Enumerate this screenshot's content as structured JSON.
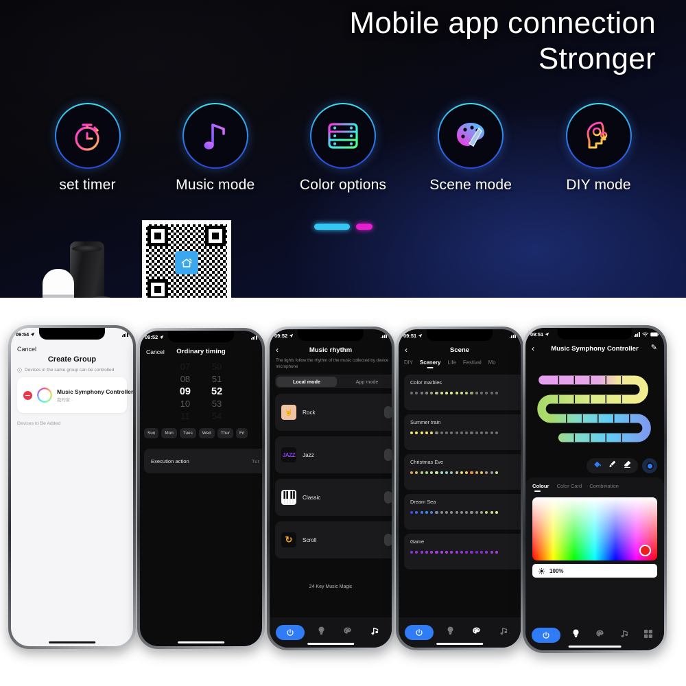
{
  "hero": {
    "title_line1": "Mobile app connection",
    "title_line2": "Stronger",
    "features": [
      {
        "label": "set timer",
        "icon": "stopwatch-timer-icon"
      },
      {
        "label": "Music mode",
        "icon": "music-note-icon"
      },
      {
        "label": "Color options",
        "icon": "led-strip-color-icon"
      },
      {
        "label": "Scene mode",
        "icon": "palette-brush-icon"
      },
      {
        "label": "DIY mode",
        "icon": "head-gears-icon"
      }
    ],
    "pager": {
      "active": "cyan-pill",
      "inactive": "magenta-pill"
    },
    "speakers_alt": "google-home-amazon-echo-speakers",
    "qr_alt": "qr-code-with-smart-home-logo"
  },
  "phones": [
    {
      "id": "create-group",
      "status": {
        "time": "09:54",
        "location_icon": "location-arrow-icon",
        "signal_icon": "signal-bars-icon"
      },
      "cancel": "Cancel",
      "title": "Create Group",
      "hint_icon": "info-icon",
      "hint": "Devices in the same group can be controlled",
      "device": {
        "name": "Music Symphony Controller",
        "sub": "我的家 ·",
        "remove_icon": "remove-minus-icon",
        "avatar_icon": "rainbow-ring-icon"
      },
      "footer": "Devices to Be Added"
    },
    {
      "id": "ordinary-timing",
      "status": {
        "time": "09:52"
      },
      "cancel": "Cancel",
      "title": "Ordinary timing",
      "hours": [
        "07",
        "08",
        "09",
        "10",
        "11"
      ],
      "minutes": [
        "50",
        "51",
        "52",
        "53",
        "54"
      ],
      "selected_hour": "09",
      "selected_minute": "52",
      "days": [
        "Sun",
        "Mon",
        "Tues",
        "Wed",
        "Thur",
        "Fri"
      ],
      "execution": {
        "label": "Execution action",
        "value": "Tur"
      }
    },
    {
      "id": "music-rhythm",
      "status": {
        "time": "09:52"
      },
      "title": "Music rhythm",
      "back_icon": "chevron-left-icon",
      "description": "The lights follow the rhythm of the music collected by device microphone",
      "segments": [
        {
          "label": "Local mode",
          "active": true
        },
        {
          "label": "App mode",
          "active": false
        }
      ],
      "modes": [
        {
          "label": "Rock",
          "icon": "rock-hand-icon",
          "glyph": "🤘"
        },
        {
          "label": "Jazz",
          "icon": "jazz-text-icon",
          "glyph": "JAZZ"
        },
        {
          "label": "Classic",
          "icon": "piano-keys-icon",
          "glyph": ""
        },
        {
          "label": "Scroll",
          "icon": "refresh-loop-icon",
          "glyph": "↻"
        }
      ],
      "overlay_label": "24 Key Music Magic",
      "bottom_nav": [
        {
          "icon": "power-icon",
          "active": true
        },
        {
          "icon": "bulb-icon",
          "active": false
        },
        {
          "icon": "palette-icon",
          "active": false
        },
        {
          "icon": "music-note-icon",
          "active": true
        }
      ]
    },
    {
      "id": "scene",
      "status": {
        "time": "09:51"
      },
      "title": "Scene",
      "back_icon": "chevron-left-icon",
      "tabs": [
        {
          "label": "DIY",
          "active": false
        },
        {
          "label": "Scenery",
          "active": true
        },
        {
          "label": "Life",
          "active": false
        },
        {
          "label": "Festival",
          "active": false
        },
        {
          "label": "Mo",
          "active": false
        }
      ],
      "scenes": [
        {
          "name": "Color marbles",
          "colors": [
            "#6e6e70",
            "#6e6e70",
            "#7d7d7f",
            "#8d8d80",
            "#a0a585",
            "#b9c98a",
            "#cfe58c",
            "#d9ee8d",
            "#dff28e",
            "#daec8c",
            "#cde28a",
            "#b8cf86",
            "#9aa87e",
            "#7d7d7f",
            "#6e6e70",
            "#6e6e70",
            "#6e6e70",
            "#6e6e70"
          ]
        },
        {
          "name": "Summer train",
          "colors": [
            "#f2e06a",
            "#f5e467",
            "#f7e765",
            "#f6e566",
            "#efdd6a",
            "#8f8f7a",
            "#6e6e70",
            "#6e6e70",
            "#6e6e70",
            "#6e6e70",
            "#6e6e70",
            "#6e6e70",
            "#6e6e70",
            "#6e6e70",
            "#6e6e70",
            "#6e6e70",
            "#6e6e70",
            "#6e6e70"
          ]
        },
        {
          "name": "Christmas Eve",
          "colors": [
            "#e0a25a",
            "#cdbd6a",
            "#b9cf7c",
            "#a8d98e",
            "#b7e39a",
            "#cfe9a6",
            "#a9dcc2",
            "#8fd2cf",
            "#9fc0b4",
            "#c9c98d",
            "#e7dc77",
            "#efc96a",
            "#f08a3c",
            "#e6b45f",
            "#d8c96a",
            "#c69a7a",
            "#9aa0a0",
            "#bfe08c"
          ]
        },
        {
          "name": "Dream Sea",
          "colors": [
            "#3a4ef0",
            "#3f63f2",
            "#3f79f4",
            "#3f8af5",
            "#4a7fe0",
            "#7e8da0",
            "#8a8a8c",
            "#8a8a8c",
            "#8a8a8c",
            "#8a8a8c",
            "#8a8a8c",
            "#8a8a8c",
            "#8a8a8c",
            "#8a8a8c",
            "#9aa982",
            "#b7d07f",
            "#cde586",
            "#d8ef89"
          ]
        },
        {
          "name": "Game",
          "colors": [
            "#8e2fe0",
            "#9633e4",
            "#9d38e7",
            "#a33ce9",
            "#a93fea",
            "#ad42ec",
            "#b046ed",
            "#ae44ec",
            "#a93fea",
            "#a23ae8",
            "#9a35e6",
            "#9230e3",
            "#8b2ce1",
            "#862ade",
            "#8f2ee2",
            "#9a34e6",
            "#a43ae9",
            "#ad41ec"
          ]
        }
      ],
      "bottom_nav": [
        {
          "icon": "power-icon",
          "active": true
        },
        {
          "icon": "bulb-icon",
          "active": false
        },
        {
          "icon": "palette-icon",
          "active": true
        },
        {
          "icon": "music-note-icon",
          "active": false
        }
      ]
    },
    {
      "id": "music-symphony-controller",
      "status": {
        "time": "09:51",
        "wifi_icon": "wifi-icon",
        "battery_icon": "battery-icon"
      },
      "title": "Music Symphony Controller",
      "back_icon": "chevron-left-icon",
      "edit_icon": "pencil-edit-icon",
      "strip_alt": "serpentine-led-strip-preview",
      "tools": [
        {
          "icon": "paint-bucket-icon",
          "active": true
        },
        {
          "icon": "brush-icon",
          "active": false
        },
        {
          "icon": "eraser-icon",
          "active": false
        }
      ],
      "color_swatch_icon": "color-swatch-icon",
      "color_tabs": [
        {
          "label": "Colour",
          "active": true
        },
        {
          "label": "Color Card",
          "active": false
        },
        {
          "label": "Combination",
          "active": false
        }
      ],
      "brightness": {
        "icon": "brightness-icon",
        "value": "100%"
      },
      "bottom_nav": [
        {
          "icon": "power-icon",
          "active": true
        },
        {
          "icon": "bulb-icon",
          "active": true
        },
        {
          "icon": "palette-icon",
          "active": false
        },
        {
          "icon": "music-note-icon",
          "active": false
        },
        {
          "icon": "grid-icon",
          "active": false
        }
      ]
    }
  ],
  "colors": {
    "accent_blue": "#2f7cf6",
    "pager_cyan": "#35c6f4",
    "pager_magenta": "#e41fd0",
    "remove_red": "#e8394a",
    "picker_red": "#f01e1e"
  }
}
